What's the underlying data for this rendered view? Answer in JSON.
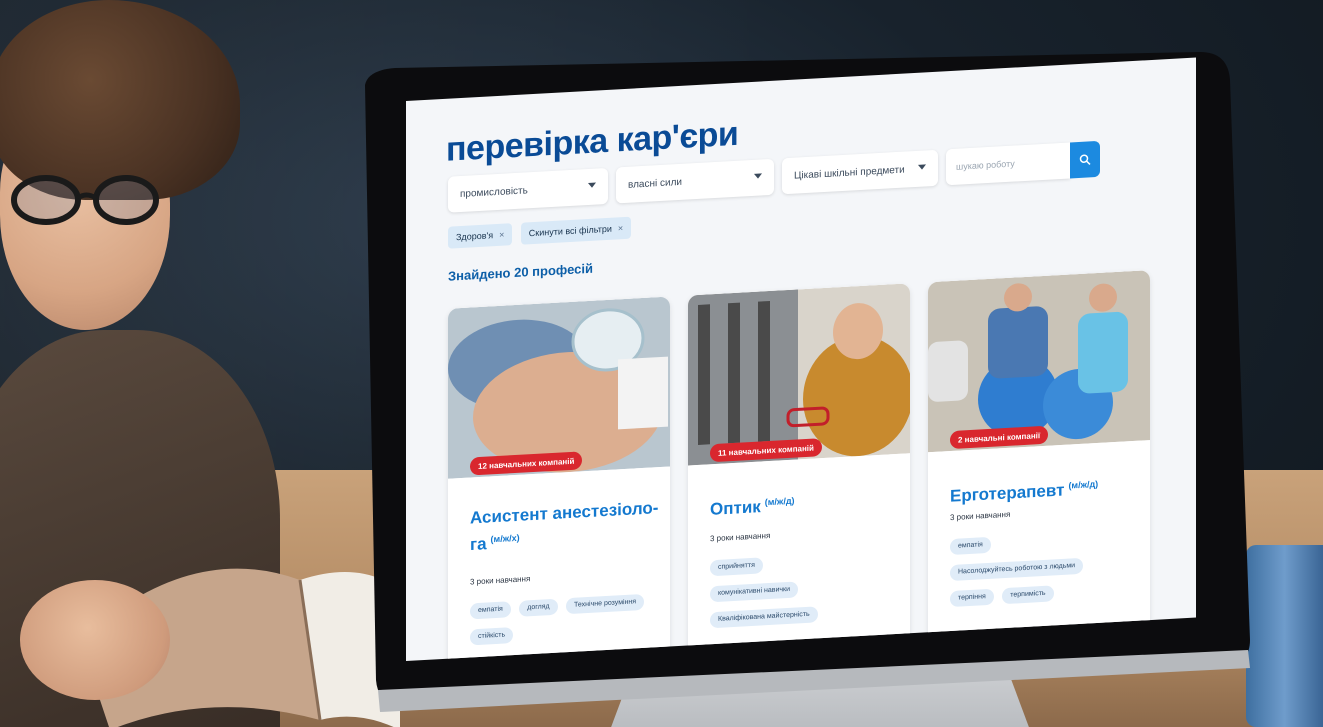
{
  "page_title": "перевірка кар'єри",
  "filters": {
    "industry": "промисловість",
    "strengths": "власні сили",
    "subjects": "Цікаві шкільні предмети",
    "search_placeholder": "шукаю роботу"
  },
  "active_chips": [
    {
      "label": "Здоров'я"
    },
    {
      "label": "Скинути всі фільтри"
    }
  ],
  "results_text": "Знайдено 20 професій",
  "cards": [
    {
      "badge": "12 навчальних компаній",
      "title": "Асистент анестезіоло­га",
      "gender": "(м/ж/х)",
      "duration": "3 роки навчання",
      "tags": [
        "емпатія",
        "догляд",
        "Технічне розуміння",
        "стійкість"
      ]
    },
    {
      "badge": "11 навчальних компаній",
      "title": "Оптик",
      "gender": "(м/ж/д)",
      "duration": "3 роки навчання",
      "tags": [
        "сприйняття",
        "комунікативні навички",
        "Кваліфікована майстерність"
      ]
    },
    {
      "badge": "2 навчальні компанії",
      "title": "Ерготерапевт",
      "gender": "(м/ж/д)",
      "duration": "3 роки навчання",
      "tags": [
        "емпатія",
        "Насолоджуйтесь роботою з людьми",
        "терпіння",
        "терпимість"
      ]
    }
  ],
  "colors": {
    "brand_blue": "#0a4b96",
    "accent_blue": "#1c8ae0",
    "badge_red": "#d9272e"
  },
  "icons": {
    "search": "search-icon",
    "close": "close-icon",
    "dropdown": "chevron-down-icon"
  }
}
